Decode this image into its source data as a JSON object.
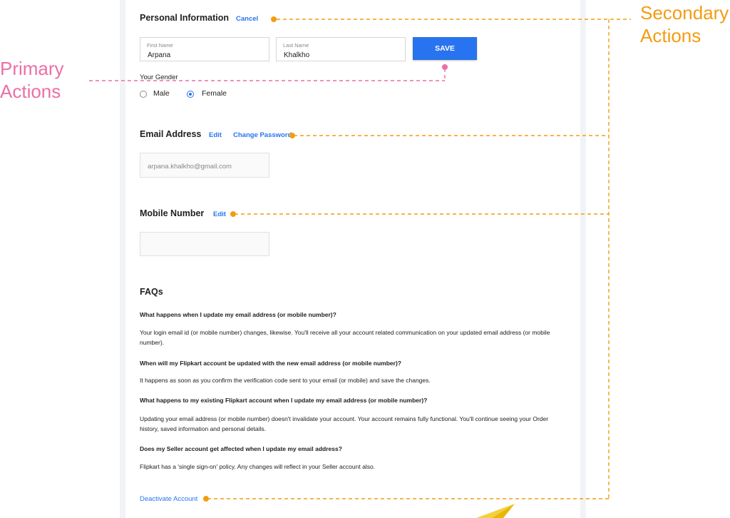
{
  "personal": {
    "title": "Personal Information",
    "cancel_label": "Cancel",
    "first_name_label": "First Name",
    "first_name_value": "Arpana",
    "last_name_label": "Last Name",
    "last_name_value": "Khalkho",
    "save_label": "SAVE",
    "gender_label": "Your Gender",
    "gender_options": [
      "Male",
      "Female"
    ],
    "gender_selected": "Female"
  },
  "email": {
    "title": "Email Address",
    "edit_label": "Edit",
    "change_password_label": "Change Password",
    "value": "arpana.khalkho@gmail.com"
  },
  "mobile": {
    "title": "Mobile Number",
    "edit_label": "Edit",
    "value": ""
  },
  "faqs": {
    "title": "FAQs",
    "items": [
      {
        "q": "What happens when I update my email address (or mobile number)?",
        "a": "Your login email id (or mobile number) changes, likewise. You'll receive all your account related communication on your updated email address (or mobile number)."
      },
      {
        "q": "When will my Flipkart account be updated with the new email address (or mobile number)?",
        "a": "It happens as soon as you confirm the verification code sent to your email (or mobile) and save the changes."
      },
      {
        "q": "What happens to my existing Flipkart account when I update my email address (or mobile number)?",
        "a": "Updating your email address (or mobile number) doesn't invalidate your account. Your account remains fully functional. You'll continue seeing your Order history, saved information and personal details."
      },
      {
        "q": "Does my Seller account get affected when I update my email address?",
        "a": "Flipkart has a 'single sign-on' policy. Any changes will reflect in your Seller account also."
      }
    ]
  },
  "deactivate_label": "Deactivate Account",
  "annotations": {
    "primary": [
      "Primary",
      "Actions"
    ],
    "secondary": [
      "Secondary",
      "Actions"
    ]
  },
  "colors": {
    "brand_blue": "#2874f0",
    "annotation_orange": "#f39c12",
    "annotation_pink": "#ec6fa6"
  },
  "icons": {
    "decoration": "paper-plane-icon"
  }
}
